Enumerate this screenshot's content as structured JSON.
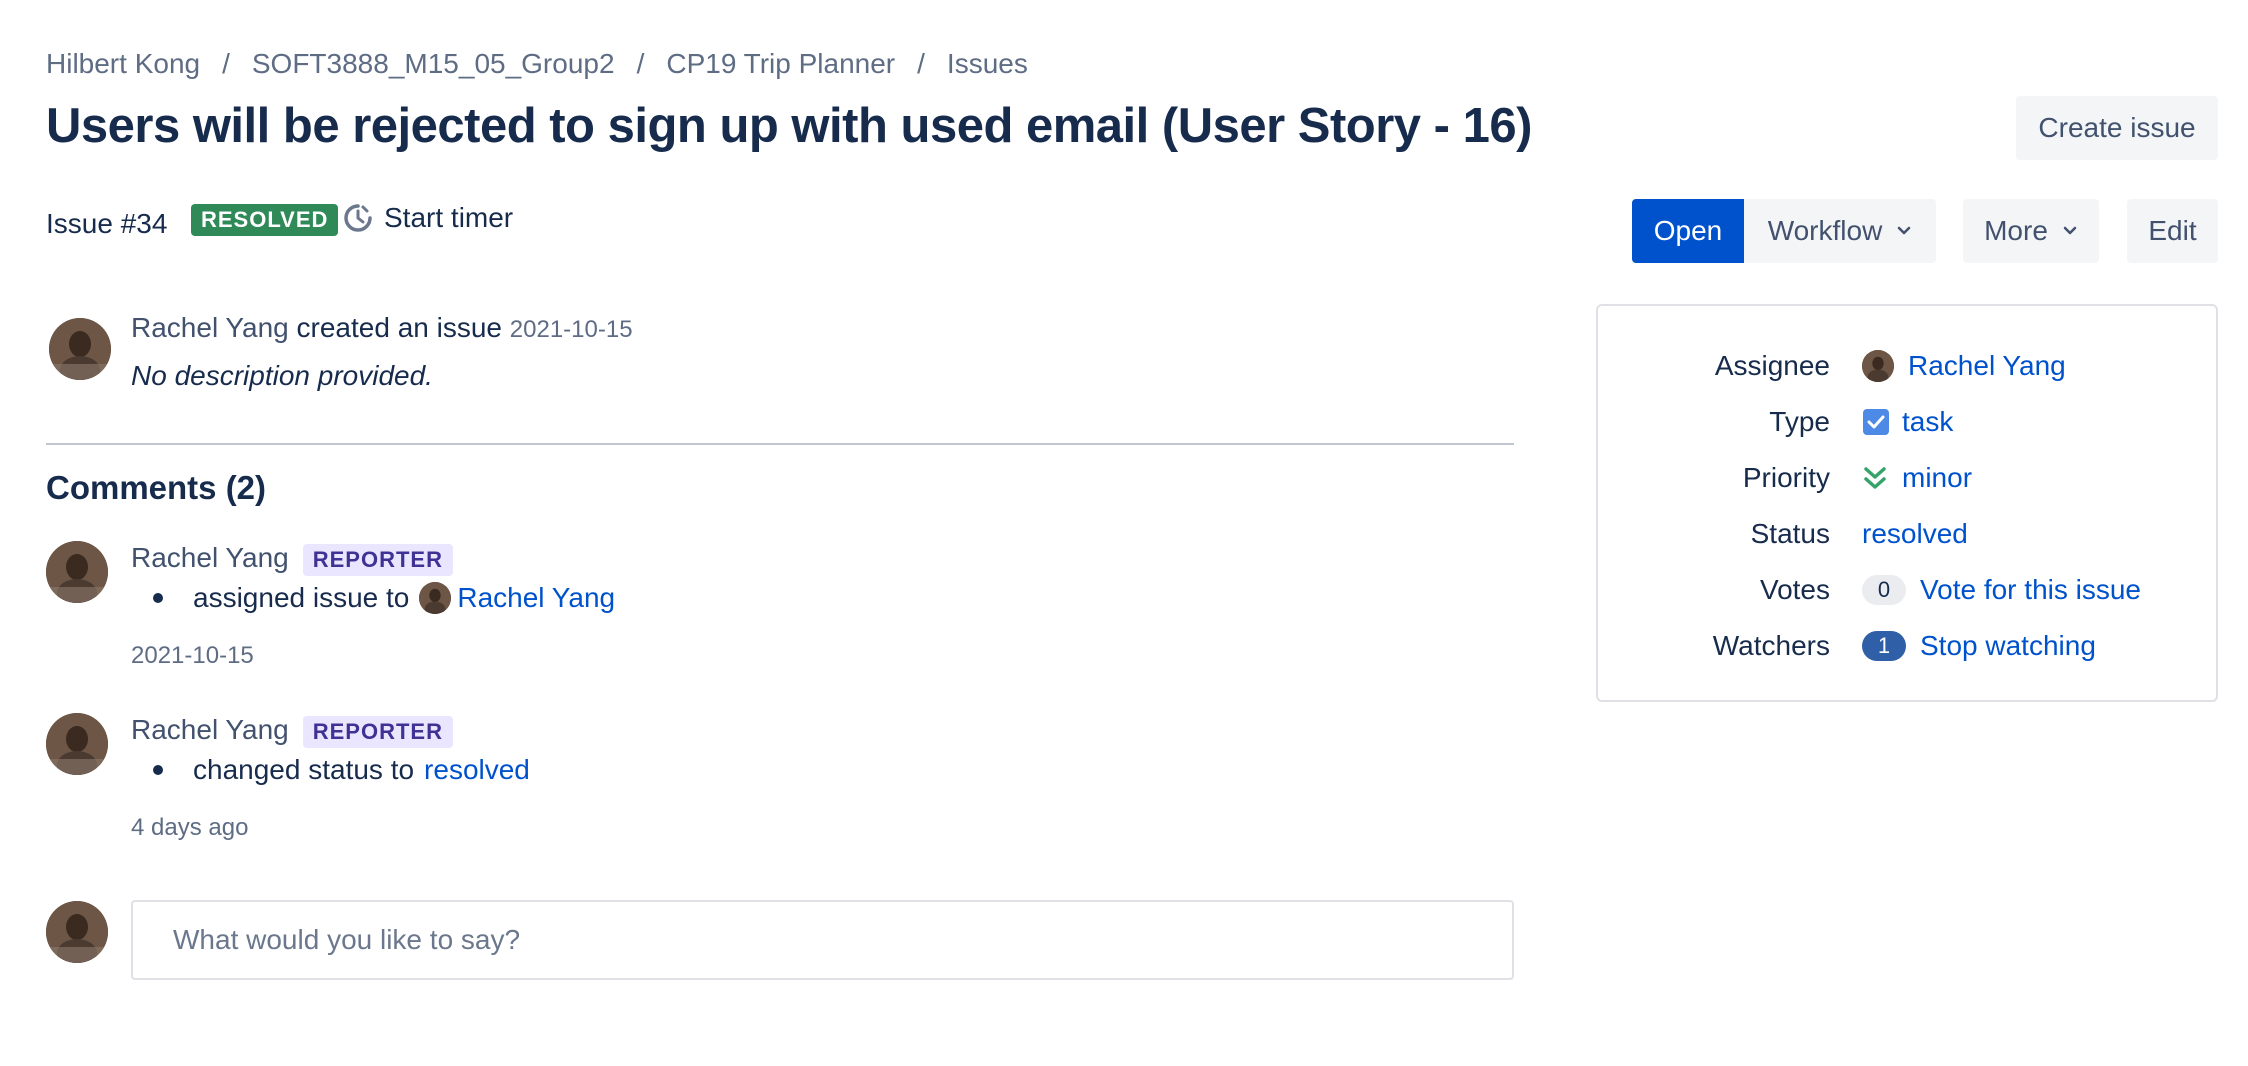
{
  "breadcrumb": {
    "items": [
      "Hilbert Kong",
      "SOFT3888_M15_05_Group2",
      "CP19 Trip Planner",
      "Issues"
    ],
    "separator": "/"
  },
  "page_title": "Users will be rejected to sign up with used email (User Story - 16)",
  "header": {
    "create_issue_label": "Create issue"
  },
  "issue": {
    "number_label": "Issue #34",
    "status_badge": "RESOLVED",
    "timer_label": "Start timer"
  },
  "actions": {
    "open_label": "Open",
    "workflow_label": "Workflow",
    "more_label": "More",
    "edit_label": "Edit"
  },
  "creation": {
    "author": "Rachel Yang",
    "action": "created an issue",
    "date": "2021-10-15",
    "description": "No description provided."
  },
  "comments": {
    "title": "Comments (2)",
    "items": [
      {
        "author": "Rachel Yang",
        "role_badge": "REPORTER",
        "text": "assigned issue to",
        "target": "Rachel Yang",
        "date": "2021-10-15"
      },
      {
        "author": "Rachel Yang",
        "role_badge": "REPORTER",
        "text": "changed status to",
        "target": "resolved",
        "date": "4 days ago"
      }
    ],
    "input_placeholder": "What would you like to say?"
  },
  "details": {
    "assignee": {
      "label": "Assignee",
      "value": "Rachel Yang"
    },
    "type": {
      "label": "Type",
      "value": "task"
    },
    "priority": {
      "label": "Priority",
      "value": "minor"
    },
    "status": {
      "label": "Status",
      "value": "resolved"
    },
    "votes": {
      "label": "Votes",
      "count": "0",
      "action": "Vote for this issue"
    },
    "watchers": {
      "label": "Watchers",
      "count": "1",
      "action": "Stop watching"
    }
  },
  "colors": {
    "primary": "#0052cc",
    "resolved_badge": "#2f8a58",
    "reporter_badge_bg": "#eae6ff",
    "reporter_badge_text": "#403294",
    "text": "#172b4d"
  },
  "icons": {
    "timer": "timer-icon",
    "chevron": "chevron-down-icon",
    "type": "checkbox-icon",
    "priority": "double-chevron-down-icon"
  }
}
